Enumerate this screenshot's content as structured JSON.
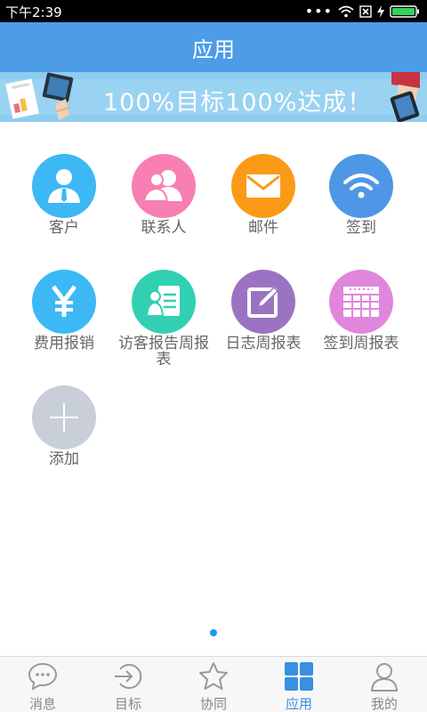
{
  "status_bar": {
    "time": "下午2:39",
    "icons": [
      "more-dots-icon",
      "wifi-icon",
      "no-sim-icon",
      "charging-icon",
      "battery-icon"
    ]
  },
  "header": {
    "title": "应用"
  },
  "banner": {
    "text": "100%目标100%达成！"
  },
  "apps": [
    {
      "label": "客户",
      "icon": "customer-icon",
      "color": "#3cb8f5"
    },
    {
      "label": "联系人",
      "icon": "contacts-icon",
      "color": "#f77fb2"
    },
    {
      "label": "邮件",
      "icon": "mail-icon",
      "color": "#fb9a16"
    },
    {
      "label": "签到",
      "icon": "wifi-signal-icon",
      "color": "#4e97e6"
    },
    {
      "label": "费用报销",
      "icon": "yen-icon",
      "color": "#3cb8f5"
    },
    {
      "label": "访客报告周报表",
      "icon": "visitor-report-icon",
      "color": "#31d0b2"
    },
    {
      "label": "日志周报表",
      "icon": "log-edit-icon",
      "color": "#9b73c2"
    },
    {
      "label": "签到周报表",
      "icon": "checkin-calendar-icon",
      "color": "#e186dd"
    },
    {
      "label": "添加",
      "icon": "plus-icon",
      "color": "#c9cfd8"
    }
  ],
  "bottom_nav": {
    "items": [
      {
        "label": "消息",
        "icon": "message-icon",
        "active": false
      },
      {
        "label": "目标",
        "icon": "target-icon",
        "active": false
      },
      {
        "label": "协同",
        "icon": "star-icon",
        "active": false
      },
      {
        "label": "应用",
        "icon": "apps-grid-icon",
        "active": true
      },
      {
        "label": "我的",
        "icon": "profile-icon",
        "active": false
      }
    ]
  },
  "colors": {
    "header": "#4d9ce8",
    "active_tab": "#3a8fe0",
    "pager_dot": "#1a9ae8"
  }
}
